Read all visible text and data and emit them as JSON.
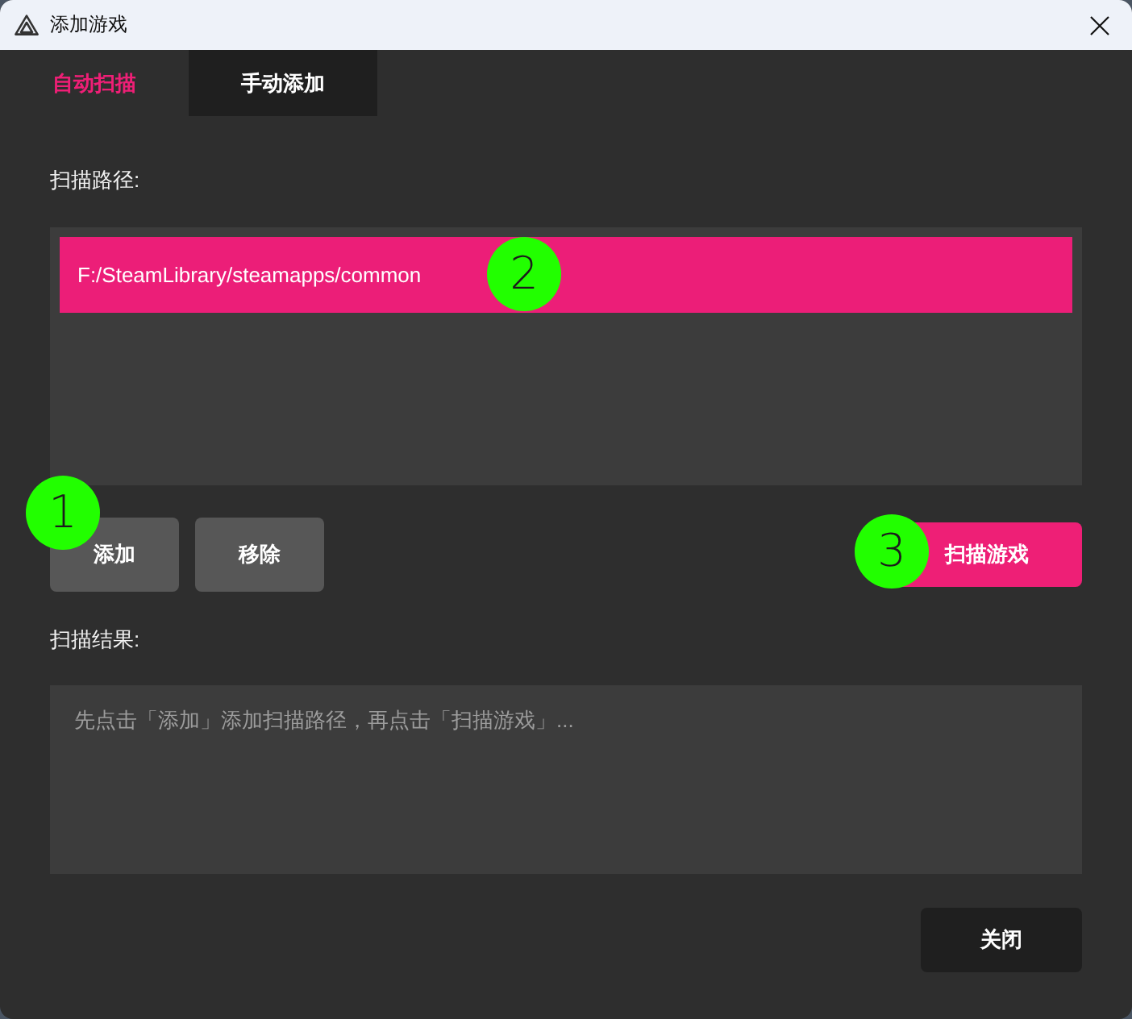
{
  "window": {
    "title": "添加游戏"
  },
  "tabs": [
    {
      "label": "自动扫描",
      "selected": true
    },
    {
      "label": "手动添加",
      "selected": false
    }
  ],
  "scan_paths": {
    "label": "扫描路径:",
    "items": [
      {
        "path": "F:/SteamLibrary/steamapps/common",
        "selected": true
      }
    ]
  },
  "actions": [
    {
      "label": "添加",
      "kind": "secondary"
    },
    {
      "label": "移除",
      "kind": "secondary"
    },
    {
      "label": "扫描游戏",
      "kind": "primary"
    }
  ],
  "scan_results": {
    "label": "扫描结果:",
    "placeholder": "先点击「添加」添加扫描路径，再点击「扫描游戏」..."
  },
  "footer_buttons": [
    {
      "label": "关闭"
    }
  ],
  "annotations": [
    {
      "label": "1"
    },
    {
      "label": "2"
    },
    {
      "label": "3"
    }
  ]
}
